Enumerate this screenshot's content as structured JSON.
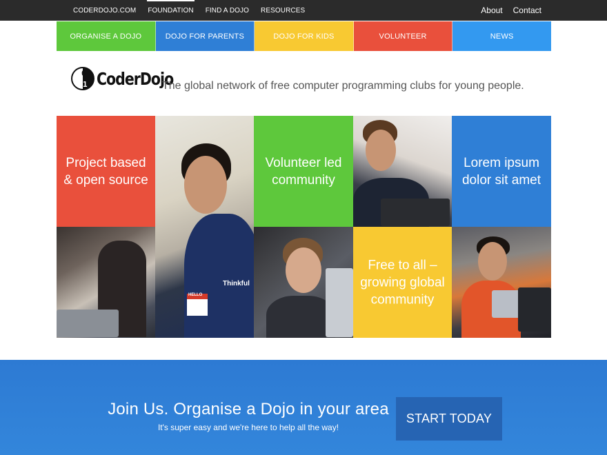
{
  "topnav": {
    "left": [
      "CODERDOJO.COM",
      "FOUNDATION",
      "FIND A DOJO",
      "RESOURCES"
    ],
    "active_index": 1,
    "right": [
      "About",
      "Contact"
    ]
  },
  "colornav": [
    {
      "label": "ORGANISE A DOJO",
      "color": "#5ec83c"
    },
    {
      "label": "DOJO FOR PARENTS",
      "color": "#2f7fd6"
    },
    {
      "label": "DOJO FOR KIDS",
      "color": "#f8c932"
    },
    {
      "label": "VOLUNTEER",
      "color": "#e9503c"
    },
    {
      "label": "NEWS",
      "color": "#3399f0"
    }
  ],
  "brand": {
    "name": "CoderDojo",
    "logo_digit_top": "0",
    "logo_digit_bottom": "1",
    "tagline": "The global network of free computer programming clubs for young people."
  },
  "tiles": {
    "project": "Project based & open source",
    "volunteer": "Volunteer led community",
    "lorem": "Lorem ipsum dolor sit amet",
    "free": "Free to all – growing global community",
    "shirt_text": "Thinkful",
    "badge_text": "HELLO"
  },
  "banner": {
    "title": "Join Us. Organise a Dojo in your area",
    "subtitle": "It's super easy and we're here to help all the way!",
    "cta": "START TODAY"
  }
}
